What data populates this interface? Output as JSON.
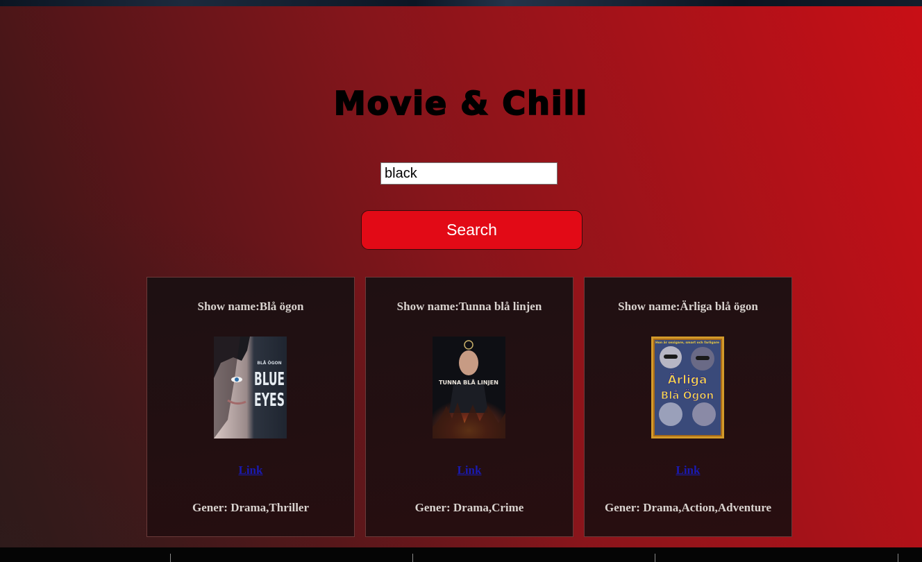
{
  "app": {
    "title": "Movie & Chill"
  },
  "search": {
    "value": "black",
    "button_label": "Search"
  },
  "results": [
    {
      "name_label": "Show name:Blå ögon",
      "link_label": "Link",
      "genre_label": "Gener: Drama,Thriller",
      "poster_text_top": "BLÅ ÖGON",
      "poster_text_main": "BLUE EYES"
    },
    {
      "name_label": "Show name:Tunna blå linjen",
      "link_label": "Link",
      "genre_label": "Gener: Drama,Crime",
      "poster_text_main": "TUNNA BLÅ LINJEN"
    },
    {
      "name_label": "Show name:Ärliga blå ögon",
      "link_label": "Link",
      "genre_label": "Gener: Drama,Action,Adventure",
      "poster_text_top": "Hon är sexigare, smart och farligare",
      "poster_text_main": "Ärliga Blå Ögon"
    }
  ],
  "colors": {
    "accent": "#e20a16",
    "card_bg": "#1f1214",
    "link": "#1a1ab0"
  }
}
